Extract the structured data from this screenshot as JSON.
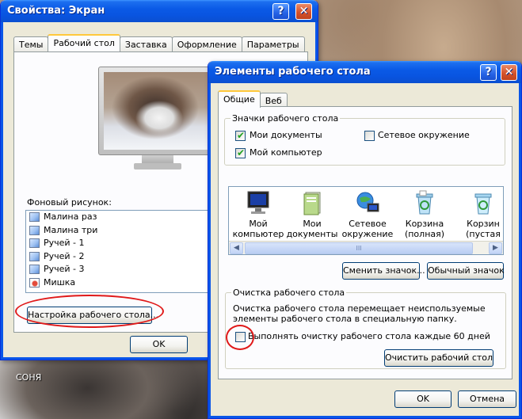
{
  "desktop": {
    "icon_label": "СОНЯ"
  },
  "display_props": {
    "title": "Свойства: Экран",
    "help_btn": "?",
    "close_btn": "✕",
    "tabs": [
      "Темы",
      "Рабочий стол",
      "Заставка",
      "Оформление",
      "Параметры"
    ],
    "active_tab": "Рабочий стол",
    "background_label": "Фоновый рисунок:",
    "backgrounds": [
      "Малина раз",
      "Малина три",
      "Ручей - 1",
      "Ручей - 2",
      "Ручей - 3",
      "Мишка"
    ],
    "selected_background": "Мишка",
    "customize_btn": "Настройка рабочего стола...",
    "ok_btn": "OK"
  },
  "desktop_items": {
    "title": "Элементы рабочего стола",
    "help_btn": "?",
    "close_btn": "✕",
    "tabs": [
      "Общие",
      "Веб"
    ],
    "active_tab": "Общие",
    "icons_group": {
      "legend": "Значки рабочего стола",
      "my_documents": "Мои документы",
      "my_computer": "Мой компьютер",
      "network": "Сетевое окружение",
      "my_documents_checked": true,
      "my_computer_checked": true,
      "network_checked": false
    },
    "icon_strip": [
      {
        "line1": "Мой",
        "line2": "компьютер",
        "icon": "monitor-icon"
      },
      {
        "line1": "Мои",
        "line2": "документы",
        "icon": "folder-icon"
      },
      {
        "line1": "Сетевое",
        "line2": "окружение",
        "icon": "network-icon"
      },
      {
        "line1": "Корзина",
        "line2": "(полная)",
        "icon": "recycle-bin-full-icon"
      },
      {
        "line1": "Корзин",
        "line2": "(пустая",
        "icon": "recycle-bin-empty-icon"
      }
    ],
    "scroll_left": "◀",
    "scroll_right": "▶",
    "scroll_grip": "III",
    "change_icon_btn": "Сменить значок...",
    "default_icon_btn": "Обычный значок",
    "cleanup_group": {
      "legend": "Очистка рабочего стола",
      "description": "Очистка рабочего стола перемещает неиспользуемые элементы рабочего стола в специальную папку.",
      "checkbox_label": "Выполнять очистку рабочего стола каждые 60 дней",
      "checkbox_checked": false,
      "clean_btn": "Очистить рабочий стол"
    },
    "ok_btn": "OK",
    "cancel_btn": "Отмена"
  }
}
